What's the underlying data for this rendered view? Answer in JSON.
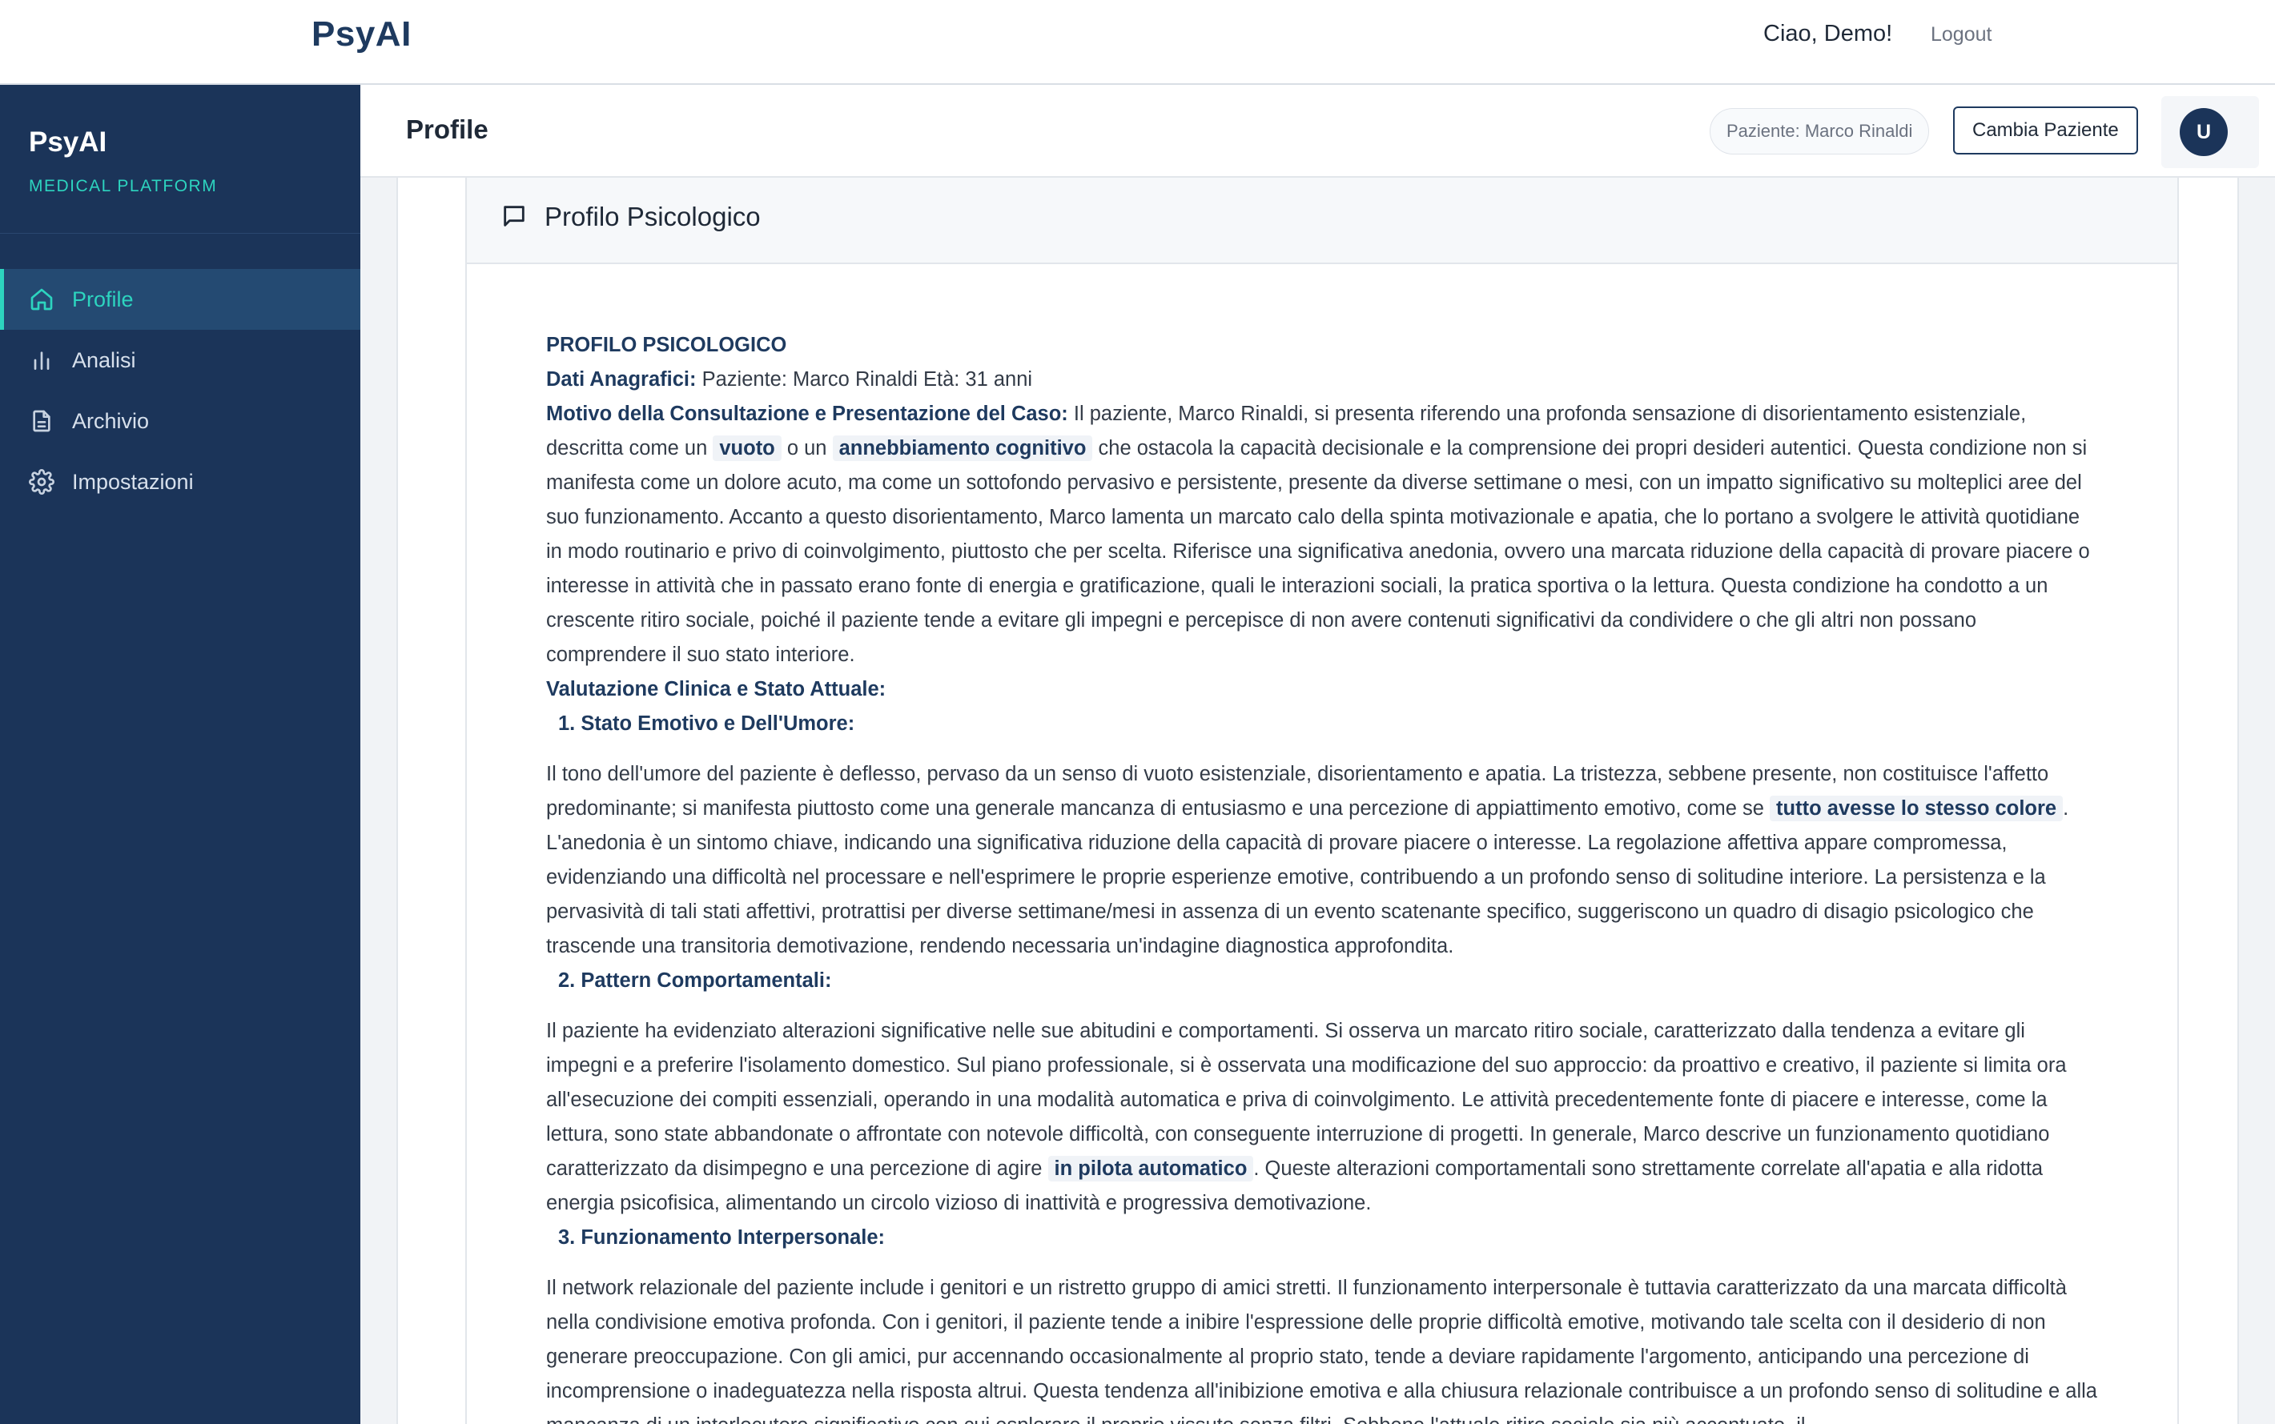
{
  "topbar": {
    "brand": "PsyAI",
    "greeting": "Ciao, Demo!",
    "logout": "Logout"
  },
  "sidebar": {
    "brand": "PsyAI",
    "subtitle": "MEDICAL PLATFORM",
    "items": [
      {
        "label": "Profile",
        "icon": "home-icon",
        "active": true
      },
      {
        "label": "Analisi",
        "icon": "bar-chart-icon",
        "active": false
      },
      {
        "label": "Archivio",
        "icon": "document-icon",
        "active": false
      },
      {
        "label": "Impostazioni",
        "icon": "gear-icon",
        "active": false
      }
    ]
  },
  "header": {
    "title": "Profile",
    "patient_chip": "Paziente: Marco Rinaldi",
    "change_button": "Cambia Paziente",
    "avatar_initial": "U"
  },
  "card": {
    "icon": "message-square-icon",
    "title": "Profilo Psicologico"
  },
  "document": {
    "heading": "PROFILO PSICOLOGICO",
    "dati_label": "Dati Anagrafici:",
    "dati_text": " Paziente: Marco Rinaldi Età: 31 anni",
    "motivo_label": "Motivo della Consultazione e Presentazione del Caso:",
    "motivo_text_1": " Il paziente, Marco Rinaldi, si presenta riferendo una profonda sensazione di disorientamento esistenziale, descritta come un ",
    "motivo_hl_1": "vuoto",
    "motivo_text_2": " o un ",
    "motivo_hl_2": "annebbiamento cognitivo",
    "motivo_text_3": " che ostacola la capacità decisionale e la comprensione dei propri desideri autentici. Questa condizione non si manifesta come un dolore acuto, ma come un sottofondo pervasivo e persistente, presente da diverse settimane o mesi, con un impatto significativo su molteplici aree del suo funzionamento. Accanto a questo disorientamento, Marco lamenta un marcato calo della spinta motivazionale e apatia, che lo portano a svolgere le attività quotidiane in modo routinario e privo di coinvolgimento, piuttosto che per scelta. Riferisce una significativa anedonia, ovvero una marcata riduzione della capacità di provare piacere o interesse in attività che in passato erano fonte di energia e gratificazione, quali le interazioni sociali, la pratica sportiva o la lettura. Questa condizione ha condotto a un crescente ritiro sociale, poiché il paziente tende a evitare gli impegni e percepisce di non avere contenuti significativi da condividere o che gli altri non possano comprendere il suo stato interiore.",
    "valutazione_label": "Valutazione Clinica e Stato Attuale:",
    "sec1_title": "1. Stato Emotivo e Dell'Umore:",
    "sec1_text_1": "Il tono dell'umore del paziente è deflesso, pervaso da un senso di vuoto esistenziale, disorientamento e apatia. La tristezza, sebbene presente, non costituisce l'affetto predominante; si manifesta piuttosto come una generale mancanza di entusiasmo e una percezione di appiattimento emotivo, come se ",
    "sec1_hl": "tutto avesse lo stesso colore",
    "sec1_text_2": ". L'anedonia è un sintomo chiave, indicando una significativa riduzione della capacità di provare piacere o interesse. La regolazione affettiva appare compromessa, evidenziando una difficoltà nel processare e nell'esprimere le proprie esperienze emotive, contribuendo a un profondo senso di solitudine interiore. La persistenza e la pervasività di tali stati affettivi, protrattisi per diverse settimane/mesi in assenza di un evento scatenante specifico, suggeriscono un quadro di disagio psicologico che trascende una transitoria demotivazione, rendendo necessaria un'indagine diagnostica approfondita.",
    "sec2_title": "2. Pattern Comportamentali:",
    "sec2_text_1": "Il paziente ha evidenziato alterazioni significative nelle sue abitudini e comportamenti. Si osserva un marcato ritiro sociale, caratterizzato dalla tendenza a evitare gli impegni e a preferire l'isolamento domestico. Sul piano professionale, si è osservata una modificazione del suo approccio: da proattivo e creativo, il paziente si limita ora all'esecuzione dei compiti essenziali, operando in una modalità automatica e priva di coinvolgimento. Le attività precedentemente fonte di piacere e interesse, come la lettura, sono state abbandonate o affrontate con notevole difficoltà, con conseguente interruzione di progetti. In generale, Marco descrive un funzionamento quotidiano caratterizzato da disimpegno e una percezione di agire ",
    "sec2_hl": "in pilota automatico",
    "sec2_text_2": ". Queste alterazioni comportamentali sono strettamente correlate all'apatia e alla ridotta energia psicofisica, alimentando un circolo vizioso di inattività e progressiva demotivazione.",
    "sec3_title": "3. Funzionamento Interpersonale:",
    "sec3_text": "Il network relazionale del paziente include i genitori e un ristretto gruppo di amici stretti. Il funzionamento interpersonale è tuttavia caratterizzato da una marcata difficoltà nella condivisione emotiva profonda. Con i genitori, il paziente tende a inibire l'espressione delle proprie difficoltà emotive, motivando tale scelta con il desiderio di non generare preoccupazione. Con gli amici, pur accennando occasionalmente al proprio stato, tende a deviare rapidamente l'argomento, anticipando una percezione di incomprensione o inadeguatezza nella risposta altrui. Questa tendenza all'inibizione emotiva e alla chiusura relazionale contribuisce a un profondo senso di solitudine e alla mancanza di un interlocutore significativo con cui esplorare il proprio vissuto senza filtri. Sebbene l'attuale ritiro sociale sia più accentuato, il"
  },
  "colors": {
    "sidebar_bg": "#1b3459",
    "accent": "#2dd4bf",
    "brand_text": "#1e3a5f"
  }
}
